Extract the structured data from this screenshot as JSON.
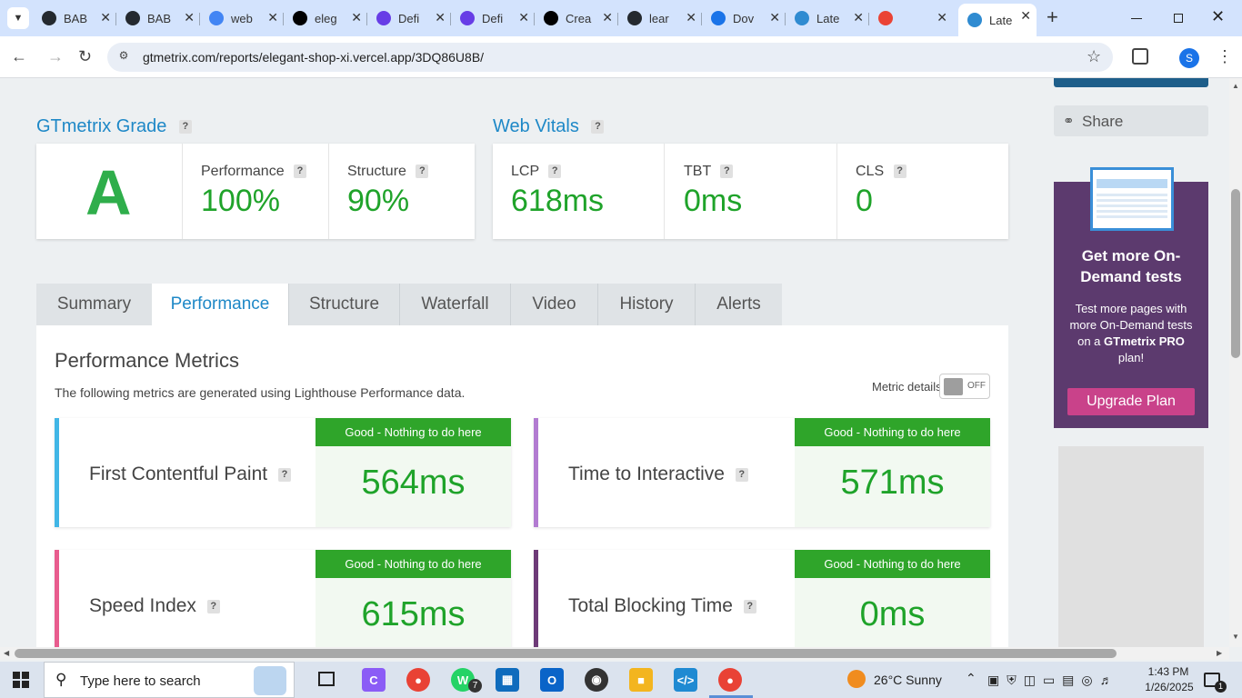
{
  "browser": {
    "tabs": [
      {
        "label": "BAB",
        "icon": "github-icon",
        "color": "#24292f"
      },
      {
        "label": "BAB",
        "icon": "github-icon",
        "color": "#24292f"
      },
      {
        "label": "web",
        "icon": "google-icon",
        "color": "#4285f4"
      },
      {
        "label": "eleg",
        "icon": "vercel-icon",
        "color": "#000000"
      },
      {
        "label": "Defi",
        "icon": "hostinger-icon",
        "color": "#673de6"
      },
      {
        "label": "Defi",
        "icon": "hostinger-icon",
        "color": "#673de6"
      },
      {
        "label": "Crea",
        "icon": "vercel-icon",
        "color": "#000000"
      },
      {
        "label": "lear",
        "icon": "github-icon",
        "color": "#24292f"
      },
      {
        "label": "Dov",
        "icon": "download-icon",
        "color": "#1a73e8"
      },
      {
        "label": "Late",
        "icon": "gtmetrix-icon",
        "color": "#2f8bd1"
      },
      {
        "label": "",
        "icon": "gmail-icon",
        "color": "#ea4335"
      },
      {
        "label": "Late",
        "icon": "gtmetrix-icon",
        "color": "#2f8bd1"
      }
    ],
    "url": "gtmetrix.com/reports/elegant-shop-xi.vercel.app/3DQ86U8B/",
    "profile_initial": "S"
  },
  "grade": {
    "title": "GTmetrix Grade",
    "letter": "A",
    "performance_label": "Performance",
    "performance_value": "100%",
    "structure_label": "Structure",
    "structure_value": "90%"
  },
  "vitals": {
    "title": "Web Vitals",
    "lcp_label": "LCP",
    "lcp_value": "618ms",
    "tbt_label": "TBT",
    "tbt_value": "0ms",
    "cls_label": "CLS",
    "cls_value": "0"
  },
  "help_mark": "?",
  "report_tabs": [
    "Summary",
    "Performance",
    "Structure",
    "Waterfall",
    "Video",
    "History",
    "Alerts"
  ],
  "active_tab": "Performance",
  "metrics_panel": {
    "title": "Performance Metrics",
    "subtitle": "The following metrics are generated using Lighthouse Performance data.",
    "toggle_label": "Metric details",
    "toggle_state": "OFF",
    "status_text": "Good - Nothing to do here",
    "good_color": "#2fa52a",
    "items": [
      {
        "name": "First Contentful Paint",
        "value": "564ms",
        "accent": "#41b6e6"
      },
      {
        "name": "Time to Interactive",
        "value": "571ms",
        "accent": "#b27bd1"
      },
      {
        "name": "Speed Index",
        "value": "615ms",
        "accent": "#e85c8e"
      },
      {
        "name": "Total Blocking Time",
        "value": "0ms",
        "accent": "#6d3a77"
      }
    ]
  },
  "sidebar": {
    "share_label": "Share",
    "promo_title": "Get more On-Demand tests",
    "promo_text_1": "Test more pages with more On-Demand tests on a ",
    "promo_brand": "GTmetrix PRO",
    "promo_text_2": " plan!",
    "upgrade_label": "Upgrade Plan",
    "promo_bg": "#5c3a6e",
    "upgrade_color": "#c9428a"
  },
  "taskbar": {
    "search_placeholder": "Type here to search",
    "weather": "26°C  Sunny",
    "time": "1:43 PM",
    "date": "1/26/2025",
    "whatsapp_badge": "7",
    "notification_count": "1"
  }
}
